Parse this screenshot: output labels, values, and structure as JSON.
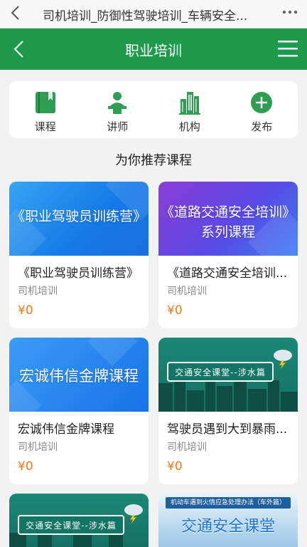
{
  "browser": {
    "title": "司机培训_防御性驾驶培训_车辆安全..."
  },
  "header": {
    "title": "职业培训"
  },
  "quicknav": [
    {
      "label": "课程",
      "icon": "book-icon"
    },
    {
      "label": "讲师",
      "icon": "lecturer-icon"
    },
    {
      "label": "机构",
      "icon": "building-icon"
    },
    {
      "label": "发布",
      "icon": "plus-circle-icon"
    }
  ],
  "section": {
    "title": "为你推荐课程"
  },
  "courses": [
    {
      "banner_text": "《职业驾驶员训练营》",
      "title": "《职业驾驶员训练营》",
      "subtitle": "司机培训",
      "price": "¥0"
    },
    {
      "banner_text": "《道路交通安全培训》",
      "banner_text2": "系列课程",
      "title": "《道路交通安全培训...",
      "subtitle": "司机培训",
      "price": "¥0"
    },
    {
      "banner_text": "宏诚伟信金牌课程",
      "title": "宏诚伟信金牌课程",
      "subtitle": "司机培训",
      "price": "¥0"
    },
    {
      "banner_text": "交通安全课堂--涉水篇",
      "title": "驾驶员遇到大到暴雨...",
      "subtitle": "司机培训",
      "price": "¥0"
    },
    {
      "banner_text": "交通安全课堂--涉水篇"
    },
    {
      "banner_top": "机动车遇到火情应急处理办法（车外篇）",
      "banner_text": "交通安全课堂"
    }
  ],
  "colors": {
    "brand_green": "#1e9a4d",
    "price_orange": "#f07b1b"
  }
}
